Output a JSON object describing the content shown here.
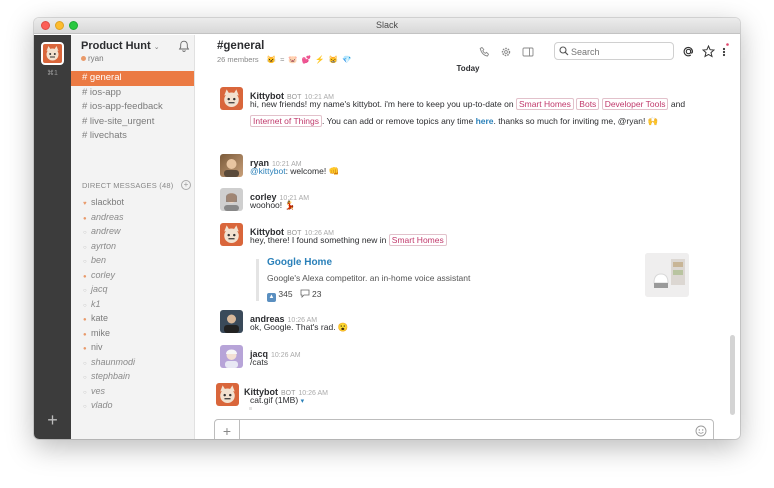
{
  "window": {
    "title": "Slack"
  },
  "teams": {
    "shortcut": "⌘1",
    "add_label": "+"
  },
  "sidebar": {
    "team_name": "Product Hunt",
    "team_chevron": "⌄",
    "user": "ryan",
    "channels": [
      "# general",
      "# ios-app",
      "# ios-app-feedback",
      "# live-site_urgent",
      "# livechats"
    ],
    "active_channel": 0,
    "dm_header": "DIRECT MESSAGES",
    "dm_count": "(48)",
    "dm_add": "+",
    "dms": [
      {
        "status": "♥",
        "name": "slackbot",
        "away": false,
        "color": "#e99a6a"
      },
      {
        "status": "●",
        "name": "andreas",
        "away": true,
        "color": "#e99a6a"
      },
      {
        "status": "○",
        "name": "andrew",
        "away": true,
        "color": "#bbb"
      },
      {
        "status": "○",
        "name": "ayrton",
        "away": true,
        "color": "#bbb"
      },
      {
        "status": "○",
        "name": "ben",
        "away": true,
        "color": "#bbb"
      },
      {
        "status": "●",
        "name": "corley",
        "away": true,
        "color": "#e99a6a"
      },
      {
        "status": "○",
        "name": "jacq",
        "away": true,
        "color": "#bbb"
      },
      {
        "status": "○",
        "name": "k1",
        "away": true,
        "color": "#bbb"
      },
      {
        "status": "●",
        "name": "kate",
        "away": false,
        "color": "#e99a6a"
      },
      {
        "status": "●",
        "name": "mike",
        "away": false,
        "color": "#e99a6a"
      },
      {
        "status": "●",
        "name": "niv",
        "away": false,
        "color": "#e99a6a"
      },
      {
        "status": "○",
        "name": "shaunmodi",
        "away": true,
        "color": "#bbb"
      },
      {
        "status": "○",
        "name": "stephbain",
        "away": true,
        "color": "#bbb"
      },
      {
        "status": "○",
        "name": "ves",
        "away": true,
        "color": "#bbb"
      },
      {
        "status": "○",
        "name": "vlado",
        "away": true,
        "color": "#bbb"
      }
    ]
  },
  "header": {
    "channel_title": "#general",
    "members": "26 members",
    "emojis": "😺 ≈ 🐷 💕 ⚡ 😸 💎",
    "search_placeholder": "Search",
    "today": "Today"
  },
  "messages": [
    {
      "author": "Kittybot",
      "bot": "BOT",
      "time": "10:21 AM",
      "line1_pre": "hi, new friends! my name's kittybot. i'm here to keep you up-to-date on",
      "line1_tags": [
        "Smart Homes",
        "Bots",
        "Developer Tools"
      ],
      "line1_post": "and",
      "line2_tag": "Internet of Things",
      "line2_pre": ". You can add or remove topics any time",
      "line2_link": "here",
      "line2_post": ". thanks so much for inviting me, @ryan! 🙌"
    },
    {
      "author": "ryan",
      "time": "10:21 AM",
      "mention": "@kittybot",
      "text": ": welcome! 👊"
    },
    {
      "author": "corley",
      "time": "10:21 AM",
      "text": "woohoo! 💃"
    },
    {
      "author": "Kittybot",
      "bot": "BOT",
      "time": "10:26 AM",
      "text": "hey, there! I found something new in",
      "tag": "Smart Homes",
      "attachment": {
        "title": "Google Home",
        "desc": "Google's Alexa competitor. an in-home voice assistant",
        "upvotes": "345",
        "comments": "23"
      }
    },
    {
      "author": "andreas",
      "time": "10:26 AM",
      "text": "ok, Google. That's rad. 😮"
    },
    {
      "author": "jacq",
      "time": "10:26 AM",
      "text": "/cats"
    },
    {
      "author": "Kittybot",
      "bot": "BOT",
      "time": "10:26 AM",
      "file": "cat.gif (1MB)",
      "file_chevron": "▾"
    }
  ],
  "composer": {
    "plus": "+",
    "placeholder": ""
  }
}
